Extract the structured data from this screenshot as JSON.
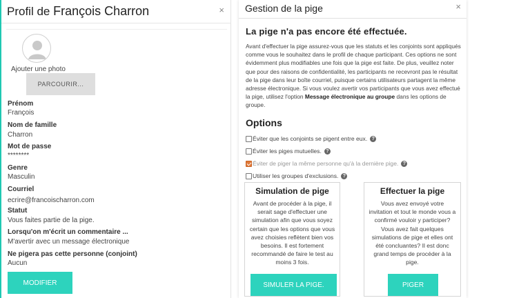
{
  "profile": {
    "title_prefix": "Profil de",
    "title_name": "François Charron",
    "add_photo_label": "Ajouter une photo",
    "browse_button": "PARCOURIR...",
    "fields": [
      {
        "label": "Prénom",
        "value": "François"
      },
      {
        "label": "Nom de famille",
        "value": "Charron"
      },
      {
        "label": "Mot de passe",
        "value": "********"
      },
      {
        "label": "Genre",
        "value": "Masculin"
      },
      {
        "label": "Courriel",
        "value": "ecrire@francoischarron.com"
      },
      {
        "label": "Statut",
        "value": "Vous faites partie de la pige."
      },
      {
        "label": "Lorsqu'on m'écrit un commentaire ...",
        "value": "M'avertir avec un message électronique"
      },
      {
        "label": "Ne pigera pas cette personne (conjoint)",
        "value": "Aucun"
      }
    ],
    "modify_button": "MODIFIER"
  },
  "draw": {
    "title": "Gestion de la pige",
    "heading": "La pige n'a pas encore été effectuée.",
    "description_1": "Avant d'effectuer la pige assurez-vous que les statuts et les conjoints sont appliqués comme vous le souhaitez dans le profil de chaque participant. Ces options ne sont évidemment plus modifiables une fois que la pige est faite. De plus, veuillez noter que pour des raisons de confidentialité, les participants ne recevront pas le résultat de la pige dans leur boîte courriel, puisque certains utilisateurs partagent la même adresse électronique. Si vous voulez avertir vos participants que vous avez effectué la pige, utilisez l'option ",
    "description_bold": "Message électronique au groupe",
    "description_2": " dans les options de groupe.",
    "options_title": "Options",
    "options": [
      {
        "label": "Éviter que les conjoints se pigent entre eux.",
        "checked": false,
        "disabled": false
      },
      {
        "label": "Éviter les piges mutuelles.",
        "checked": false,
        "disabled": false
      },
      {
        "label": "Éviter de piger la même personne qu'à la dernière pige.",
        "checked": true,
        "disabled": true
      },
      {
        "label": "Utiliser les groupes d'exclusions.",
        "checked": false,
        "disabled": false
      }
    ],
    "simulation": {
      "title": "Simulation de pige",
      "text": "Avant de procéder à la pige, il serait sage d'effectuer une simulation afin que vous soyez certain que les options que vous avez choisies reflètent bien vos besoins. Il est fortement recommandé de faire le test au moins 3 fois.",
      "button": "SIMULER LA PIGE."
    },
    "perform": {
      "title": "Effectuer la pige",
      "text": "Vous avez envoyé votre invitation et tout le monde vous a confirmé vouloir y participer? Vous avez fait quelques simulations de pige et elles ont été concluantes? Il est donc grand temps de procéder à la pige.",
      "button": "PIGER"
    }
  },
  "colors": {
    "accent": "#2dd3bd",
    "checkbox_checked": "#e07a3a"
  },
  "icons": {
    "close": "close-icon",
    "help": "help-icon",
    "avatar": "avatar-icon"
  }
}
